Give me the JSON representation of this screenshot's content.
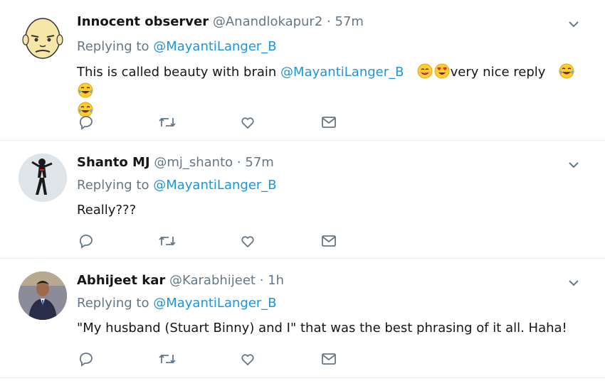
{
  "tweets": [
    {
      "name": "Innocent observer",
      "handle": "@Anandlokapur2",
      "dot": "·",
      "time": "57m",
      "replying_prefix": "Replying to",
      "replying_to": "@MayantiLanger_B",
      "text_before": "This is called beauty with brain",
      "mention": "@MayantiLanger_B",
      "text_middle": "very nice reply",
      "avatar_icon": "bald-cartoon-face-avatar",
      "emojis_a": [
        "smiling-face-icon",
        "heart-eyes-face-icon"
      ],
      "emojis_b": [
        "tears-of-joy-icon",
        "tears-of-joy-icon"
      ],
      "emojis_c": [
        "tears-of-joy-icon"
      ]
    },
    {
      "name": "Shanto MJ",
      "handle": "@mj_shanto",
      "dot": "·",
      "time": "57m",
      "replying_prefix": "Replying to",
      "replying_to": "@MayantiLanger_B",
      "text": "Really???",
      "avatar_icon": "dancer-silhouette-avatar"
    },
    {
      "name": "Abhijeet kar",
      "handle": "@Karabhijeet",
      "dot": "·",
      "time": "1h",
      "replying_prefix": "Replying to",
      "replying_to": "@MayantiLanger_B",
      "text": "\"My husband (Stuart Binny) and I\" that was the best phrasing of it all. Haha!",
      "avatar_icon": "man-in-suit-photo-avatar"
    }
  ],
  "action_icons": [
    "reply-icon",
    "retweet-icon",
    "like-icon",
    "direct-message-icon"
  ],
  "colors": {
    "link": "#1b95e0",
    "muted": "#657786",
    "text": "#14171a",
    "divider": "#e6ecf0",
    "icon": "#657786"
  }
}
